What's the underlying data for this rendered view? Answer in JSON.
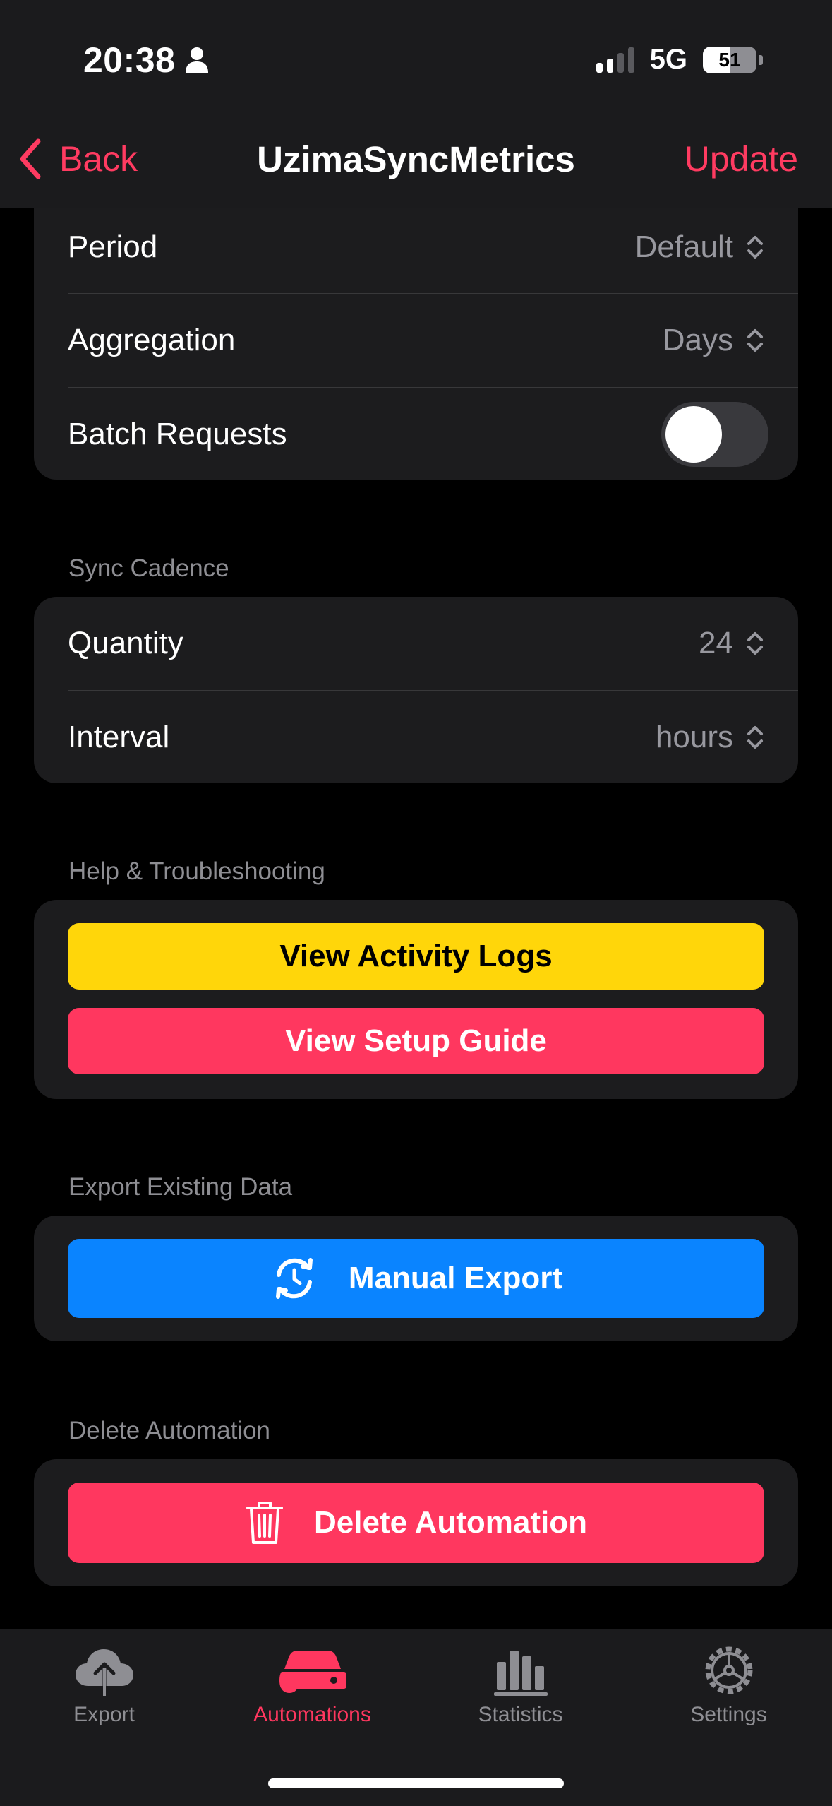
{
  "status_bar": {
    "time": "20:38",
    "network": "5G",
    "battery": "51",
    "battery_level": 0.51
  },
  "nav": {
    "back_label": "Back",
    "title": "UzimaSyncMetrics",
    "update_label": "Update"
  },
  "settings_group": {
    "rows": [
      {
        "label": "Period",
        "value": "Default"
      },
      {
        "label": "Aggregation",
        "value": "Days"
      }
    ],
    "batch_label": "Batch Requests",
    "batch_enabled": false
  },
  "sync_cadence": {
    "header": "Sync Cadence",
    "rows": [
      {
        "label": "Quantity",
        "value": "24"
      },
      {
        "label": "Interval",
        "value": "hours"
      }
    ]
  },
  "help": {
    "header": "Help & Troubleshooting",
    "activity_logs_label": "View Activity Logs",
    "setup_guide_label": "View Setup Guide"
  },
  "export": {
    "header": "Export Existing Data",
    "manual_export_label": "Manual Export"
  },
  "delete": {
    "header": "Delete Automation",
    "delete_label": "Delete Automation"
  },
  "tabs": [
    {
      "label": "Export",
      "icon": "cloud-upload-icon",
      "active": false
    },
    {
      "label": "Automations",
      "icon": "automations-icon",
      "active": true
    },
    {
      "label": "Statistics",
      "icon": "bar-chart-icon",
      "active": false
    },
    {
      "label": "Settings",
      "icon": "gear-icon",
      "active": false
    }
  ],
  "colors": {
    "accent": "#ff375f",
    "yellow_button": "#ffd60a",
    "blue_button": "#0a84ff",
    "background": "#000000",
    "card": "#1c1c1e"
  }
}
